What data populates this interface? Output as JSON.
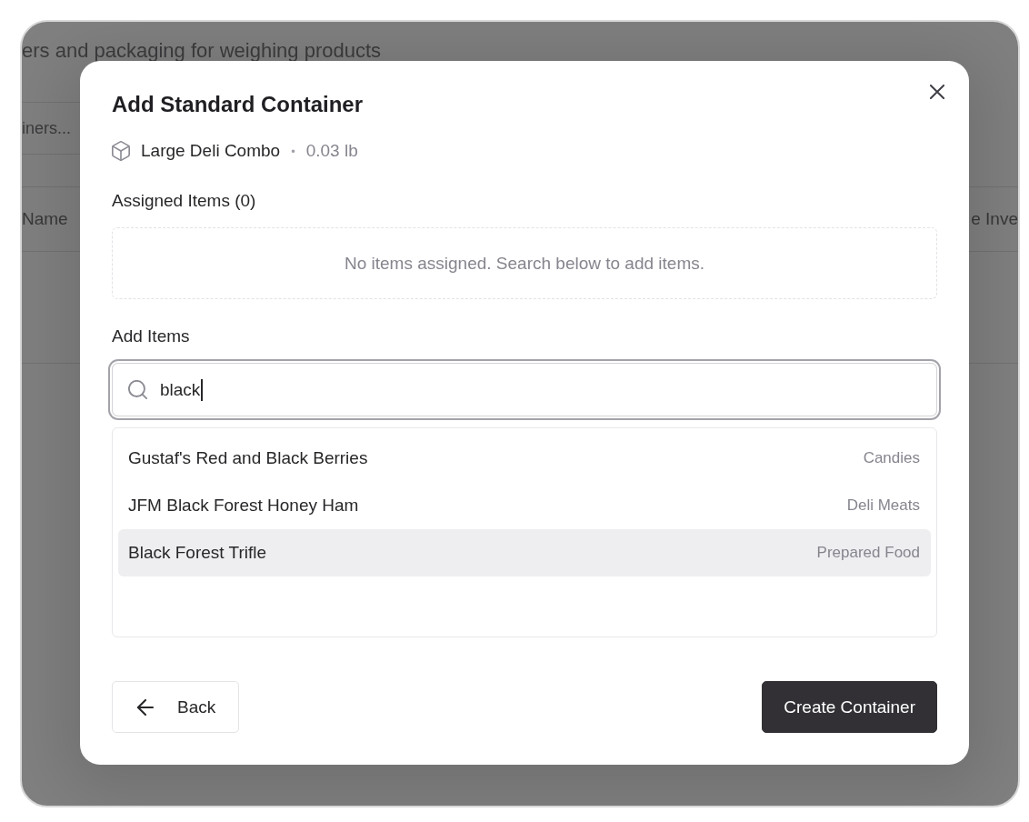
{
  "background_page": {
    "subtitle": "ers and packaging for weighing products",
    "search": {
      "placeholder": "iners..."
    },
    "table": {
      "columns": [
        "Name",
        "e Inve"
      ]
    }
  },
  "dialog": {
    "title": "Add Standard Container",
    "container": {
      "name": "Large Deli Combo",
      "separator": "•",
      "weight": "0.03 lb"
    },
    "assigned": {
      "label": "Assigned Items (0)",
      "empty_message": "No items assigned. Search below to add items."
    },
    "add_items": {
      "label": "Add Items",
      "search": {
        "value": "black"
      },
      "results": [
        {
          "name": "Gustaf's Red and Black Berries",
          "category": "Candies",
          "selected": false
        },
        {
          "name": "JFM Black Forest Honey Ham",
          "category": "Deli Meats",
          "selected": false
        },
        {
          "name": "Black Forest Trifle",
          "category": "Prepared Food",
          "selected": true
        }
      ]
    },
    "buttons": [
      {
        "kind": "back",
        "label": "Back"
      },
      {
        "kind": "primary",
        "label": "Create Container"
      }
    ]
  }
}
